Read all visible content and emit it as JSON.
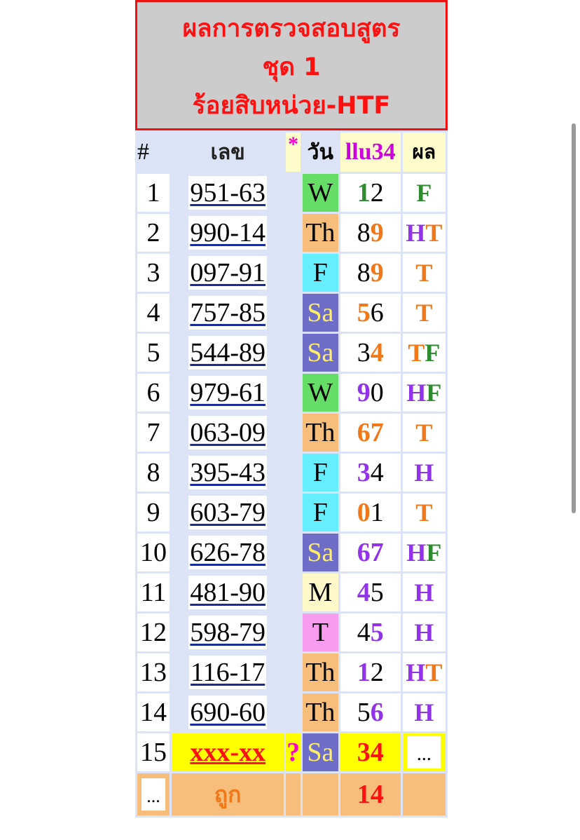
{
  "header": {
    "line1": "ผลการตรวจสอบสูตร",
    "line2": "ชุด 1",
    "line3": "ร้อยสิบหน่วย-HTF"
  },
  "columns": {
    "num": "#",
    "lek": "เลข",
    "star": "*",
    "day": "วัน",
    "prev": "llu34",
    "result": "ผล"
  },
  "rows": [
    {
      "n": "1",
      "lek": "951-63",
      "day": "W",
      "prev": [
        {
          "t": "1",
          "c": "g"
        },
        {
          "t": "2",
          "c": ""
        }
      ],
      "res": [
        {
          "t": "F",
          "c": "g"
        }
      ]
    },
    {
      "n": "2",
      "lek": "990-14",
      "day": "Th",
      "prev": [
        {
          "t": "8",
          "c": ""
        },
        {
          "t": "9",
          "c": "o"
        }
      ],
      "res": [
        {
          "t": "H",
          "c": "p"
        },
        {
          "t": "T",
          "c": "o"
        }
      ]
    },
    {
      "n": "3",
      "lek": "097-91",
      "day": "F",
      "prev": [
        {
          "t": "8",
          "c": ""
        },
        {
          "t": "9",
          "c": "o"
        }
      ],
      "res": [
        {
          "t": "T",
          "c": "o"
        }
      ]
    },
    {
      "n": "4",
      "lek": "757-85",
      "day": "Sa",
      "prev": [
        {
          "t": "5",
          "c": "o"
        },
        {
          "t": "6",
          "c": ""
        }
      ],
      "res": [
        {
          "t": "T",
          "c": "o"
        }
      ]
    },
    {
      "n": "5",
      "lek": "544-89",
      "day": "Sa",
      "prev": [
        {
          "t": "3",
          "c": ""
        },
        {
          "t": "4",
          "c": "o"
        }
      ],
      "res": [
        {
          "t": "T",
          "c": "o"
        },
        {
          "t": "F",
          "c": "g"
        }
      ]
    },
    {
      "n": "6",
      "lek": "979-61",
      "day": "W",
      "prev": [
        {
          "t": "9",
          "c": "p"
        },
        {
          "t": "0",
          "c": ""
        }
      ],
      "res": [
        {
          "t": "H",
          "c": "p"
        },
        {
          "t": "F",
          "c": "g"
        }
      ]
    },
    {
      "n": "7",
      "lek": "063-09",
      "day": "Th",
      "prev": [
        {
          "t": "6",
          "c": "o"
        },
        {
          "t": "7",
          "c": "o"
        }
      ],
      "res": [
        {
          "t": "T",
          "c": "o"
        }
      ]
    },
    {
      "n": "8",
      "lek": "395-43",
      "day": "F",
      "prev": [
        {
          "t": "3",
          "c": "p"
        },
        {
          "t": "4",
          "c": ""
        }
      ],
      "res": [
        {
          "t": "H",
          "c": "p"
        }
      ]
    },
    {
      "n": "9",
      "lek": "603-79",
      "day": "F",
      "prev": [
        {
          "t": "0",
          "c": "o"
        },
        {
          "t": "1",
          "c": ""
        }
      ],
      "res": [
        {
          "t": "T",
          "c": "o"
        }
      ]
    },
    {
      "n": "10",
      "lek": "626-78",
      "day": "Sa",
      "prev": [
        {
          "t": "6",
          "c": "p"
        },
        {
          "t": "7",
          "c": "p"
        }
      ],
      "res": [
        {
          "t": "H",
          "c": "p"
        },
        {
          "t": "F",
          "c": "g"
        }
      ]
    },
    {
      "n": "11",
      "lek": "481-90",
      "day": "M",
      "prev": [
        {
          "t": "4",
          "c": "p"
        },
        {
          "t": "5",
          "c": ""
        }
      ],
      "res": [
        {
          "t": "H",
          "c": "p"
        }
      ]
    },
    {
      "n": "12",
      "lek": "598-79",
      "day": "T",
      "prev": [
        {
          "t": "4",
          "c": ""
        },
        {
          "t": "5",
          "c": "p"
        }
      ],
      "res": [
        {
          "t": "H",
          "c": "p"
        }
      ]
    },
    {
      "n": "13",
      "lek": "116-17",
      "day": "Th",
      "prev": [
        {
          "t": "1",
          "c": "p"
        },
        {
          "t": "2",
          "c": ""
        }
      ],
      "res": [
        {
          "t": "H",
          "c": "p"
        },
        {
          "t": "T",
          "c": "o"
        }
      ]
    },
    {
      "n": "14",
      "lek": "690-60",
      "day": "Th",
      "prev": [
        {
          "t": "5",
          "c": ""
        },
        {
          "t": "6",
          "c": "p"
        }
      ],
      "res": [
        {
          "t": "H",
          "c": "p"
        }
      ]
    }
  ],
  "pending": {
    "n": "15",
    "lek": "xxx-xx",
    "mark": "?",
    "day": "Sa",
    "prev": "34",
    "res": "..."
  },
  "footer": {
    "btn": "...",
    "label": "ถูก",
    "count": "14"
  },
  "colors": {
    "header_bg": "#cccccc",
    "header_text": "#ff1111",
    "table_bg": "#dce3f6",
    "green": "#2e8b2e",
    "orange": "#f07818",
    "purple": "#9233ea",
    "highlight": "#ffff00"
  }
}
